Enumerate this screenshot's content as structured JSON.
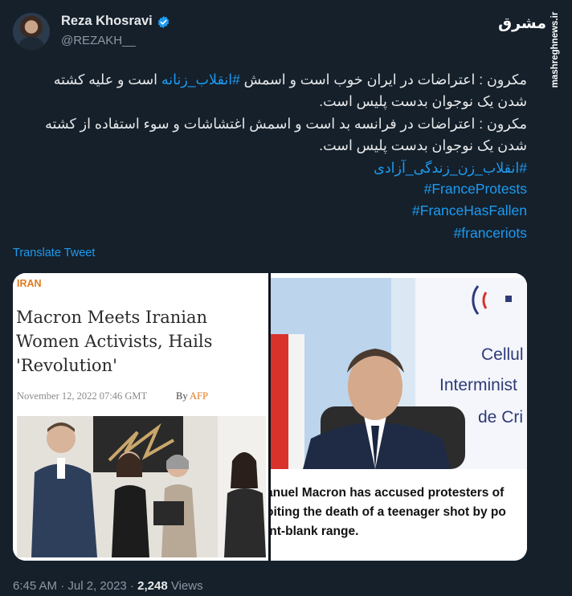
{
  "author": {
    "name": "Reza Khosravi",
    "handle": "@REZAKH__"
  },
  "watermark": {
    "logo_text": "مشرق",
    "site": "mashreghnews.ir"
  },
  "tweet": {
    "line1": "مکرون : اعتراضات در ایران خوب است و اسمش",
    "hashtag_inline": "#انقلاب_زنانه",
    "line1_end": "است و علیه کشته",
    "line2": "شدن یک نوجوان بدست پلیس است.",
    "line3": "مکرون : اعتراضات در فرانسه بد است و اسمش اغتشاشات و سوء استفاده از کشته",
    "line4": "شدن یک نوجوان بدست پلیس است.",
    "hashtags": [
      "#انقلاب_زن_زندگی_آزادی",
      "#FranceProtests",
      "#FranceHasFallen",
      "#franceriots"
    ]
  },
  "translate_label": "Translate Tweet",
  "media": {
    "left": {
      "section": "IRAN",
      "headline": "Macron Meets Iranian Women Activists, Hails 'Revolution'",
      "date": "November 12, 2022 07:46 GMT",
      "byline_prefix": "By",
      "agency": "AFP"
    },
    "right": {
      "screen_text_1": "Cellul",
      "screen_text_2": "Interminist",
      "screen_text_3": "de Cri",
      "caption_lines": [
        "anuel Macron has accused protesters of",
        "oiting the death of a teenager shot by po",
        "int-blank range."
      ]
    }
  },
  "footer": {
    "time": "6:45 AM",
    "date": "Jul 2, 2023",
    "views_count": "2,248",
    "views_label": "Views"
  },
  "colors": {
    "background": "#15202b",
    "link": "#1d9bf0",
    "text": "#e7e9ea",
    "muted": "#8b98a5",
    "verified": "#1d9bf0"
  }
}
